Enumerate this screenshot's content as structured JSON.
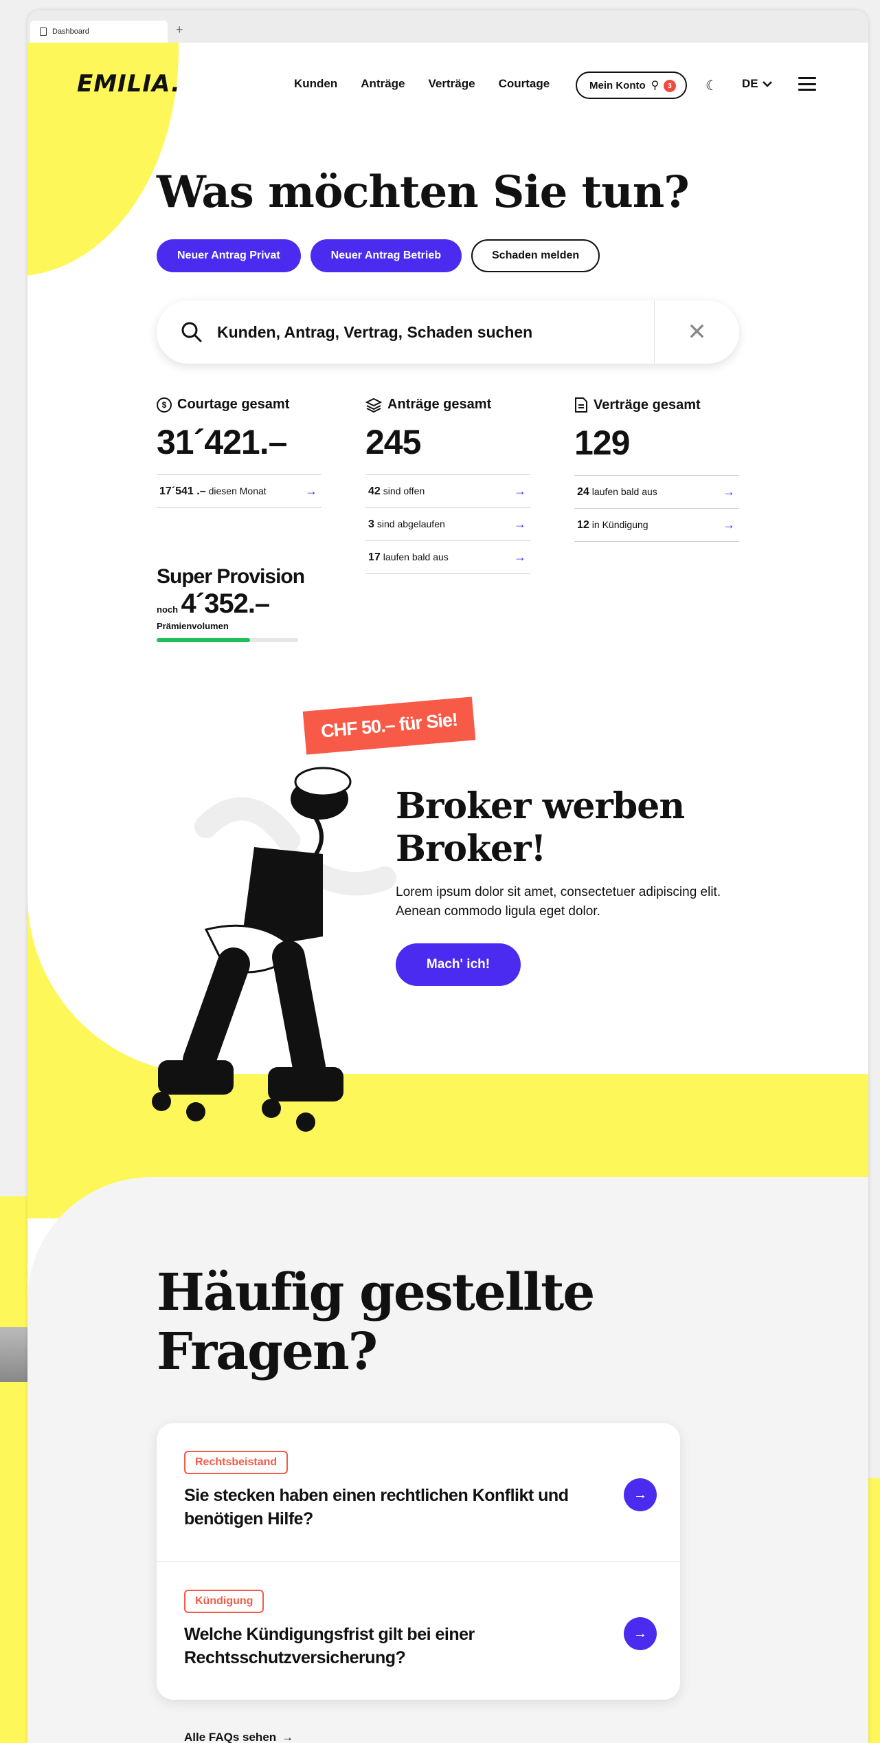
{
  "browser": {
    "tab_title": "Dashboard",
    "new_tab": "+"
  },
  "brand": {
    "logo": "EMILIA.",
    "accent": "#4b2bf0",
    "yellow": "#fdf75a",
    "coral": "#f75a46",
    "green": "#1fbf5a"
  },
  "nav": {
    "items": [
      "Kunden",
      "Anträge",
      "Verträge",
      "Courtage"
    ],
    "account_label": "Mein Konto",
    "account_badge": "3",
    "language": "DE"
  },
  "hero": {
    "headline": "Was möchten Sie tun?",
    "buttons": [
      "Neuer Antrag Privat",
      "Neuer Antrag Betrieb",
      "Schaden melden"
    ]
  },
  "search": {
    "value": "Kunden, Antrag, Vertrag, Schaden suchen",
    "clear": "✕"
  },
  "stats": [
    {
      "title": "Courtage gesamt",
      "icon": "dollar-circle-icon",
      "value": "31´421.–",
      "rows": [
        {
          "num": "17´541 .–",
          "text": "diesen Monat"
        }
      ]
    },
    {
      "title": "Anträge gesamt",
      "icon": "layers-icon",
      "value": "245",
      "rows": [
        {
          "num": "42",
          "text": "sind offen"
        },
        {
          "num": "3",
          "text": "sind abgelaufen"
        },
        {
          "num": "17",
          "text": "laufen bald aus"
        }
      ]
    },
    {
      "title": "Verträge gesamt",
      "icon": "document-icon",
      "value": "129",
      "rows": [
        {
          "num": "24",
          "text": "laufen bald aus"
        },
        {
          "num": "12",
          "text": "in Kündigung"
        }
      ]
    }
  ],
  "provision": {
    "title": "Super Provision",
    "prefix": "noch",
    "value": "4´352.–",
    "label": "Prämienvolumen",
    "progress": 0.66
  },
  "promo": {
    "tag": "CHF 50.– für Sie!",
    "title_line1": "Broker werben",
    "title_line2": "Broker!",
    "text": "Lorem ipsum dolor sit amet, consectetuer adipiscing elit. Aenean commodo ligula eget dolor.",
    "button": "Mach' ich!"
  },
  "faq": {
    "title_line1": "Häufig gestellte",
    "title_line2": "Fragen?",
    "items": [
      {
        "tag": "Rechtsbeistand",
        "question": "Sie stecken haben einen rechtlichen Konflikt und benötigen Hilfe?"
      },
      {
        "tag": "Kündigung",
        "question": "Welche Kündigungsfrist gilt bei einer Rechtsschutzversicherung?"
      }
    ],
    "all_link": "Alle FAQs sehen"
  }
}
